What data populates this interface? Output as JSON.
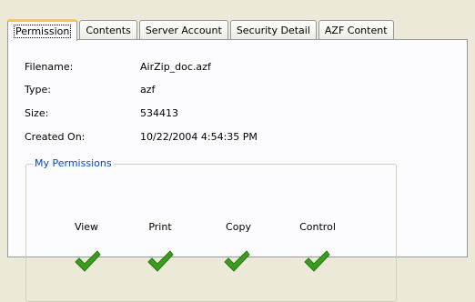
{
  "tabs": [
    {
      "label": "Permission",
      "active": true
    },
    {
      "label": "Contents",
      "active": false
    },
    {
      "label": "Server Account",
      "active": false
    },
    {
      "label": "Security Detail",
      "active": false
    },
    {
      "label": "AZF Content",
      "active": false
    }
  ],
  "file_info": {
    "filename": {
      "label": "Filename:",
      "value": "AirZip_doc.azf"
    },
    "type": {
      "label": "Type:",
      "value": "azf"
    },
    "size": {
      "label": "Size:",
      "value": "534413"
    },
    "created": {
      "label": "Created On:",
      "value": "10/22/2004 4:54:35 PM"
    }
  },
  "permissions": {
    "title": "My Permissions",
    "items": [
      {
        "label": "View",
        "granted": true,
        "icon": "check-icon"
      },
      {
        "label": "Print",
        "granted": true,
        "icon": "check-icon"
      },
      {
        "label": "Copy",
        "granted": true,
        "icon": "check-icon"
      },
      {
        "label": "Control",
        "granted": true,
        "icon": "check-icon"
      }
    ],
    "check_color": "#3a9c1e"
  },
  "colors": {
    "active_tab_accent": "#ffc83c",
    "group_title": "#0046d5",
    "window_background": "#ece9d8"
  }
}
